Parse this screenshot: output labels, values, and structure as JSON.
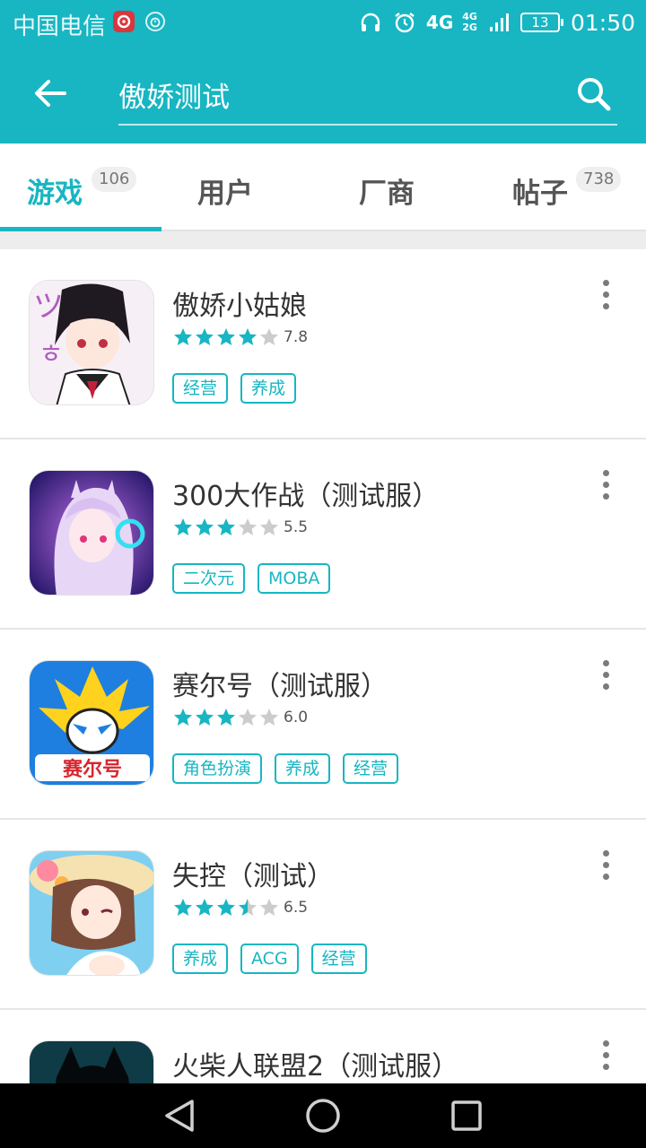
{
  "status_bar": {
    "carrier": "中国电信",
    "network": "4G",
    "network_small_top": "4G",
    "network_small_bottom": "2G",
    "battery": "13",
    "time": "01:50"
  },
  "search": {
    "query": "傲娇测试",
    "back_icon": "back-arrow-icon",
    "search_icon": "search-icon"
  },
  "tabs": [
    {
      "label": "游戏",
      "count": "106",
      "active": true
    },
    {
      "label": "用户",
      "count": ""
    },
    {
      "label": "厂商",
      "count": ""
    },
    {
      "label": "帖子",
      "count": "738"
    }
  ],
  "colors": {
    "accent": "#17b6c2",
    "star_on": "#17b6c2",
    "star_off": "#cccccc"
  },
  "results": [
    {
      "title": "傲娇小姑娘",
      "rating": "7.8",
      "stars": 4,
      "tags": [
        "经营",
        "养成"
      ]
    },
    {
      "title": "300大作战（测试服）",
      "rating": "5.5",
      "stars": 3,
      "tags": [
        "二次元",
        "MOBA"
      ]
    },
    {
      "title": "赛尔号（测试服）",
      "rating": "6.0",
      "stars": 3,
      "tags": [
        "角色扮演",
        "养成",
        "经营"
      ]
    },
    {
      "title": "失控（测试）",
      "rating": "6.5",
      "stars": 3.5,
      "tags": [
        "养成",
        "ACG",
        "经营"
      ]
    },
    {
      "title": "火柴人联盟2（测试服）",
      "rating": "",
      "stars": 0,
      "tags": []
    }
  ],
  "nav": {
    "back": "nav-back-icon",
    "home": "nav-home-icon",
    "recents": "nav-recents-icon"
  }
}
